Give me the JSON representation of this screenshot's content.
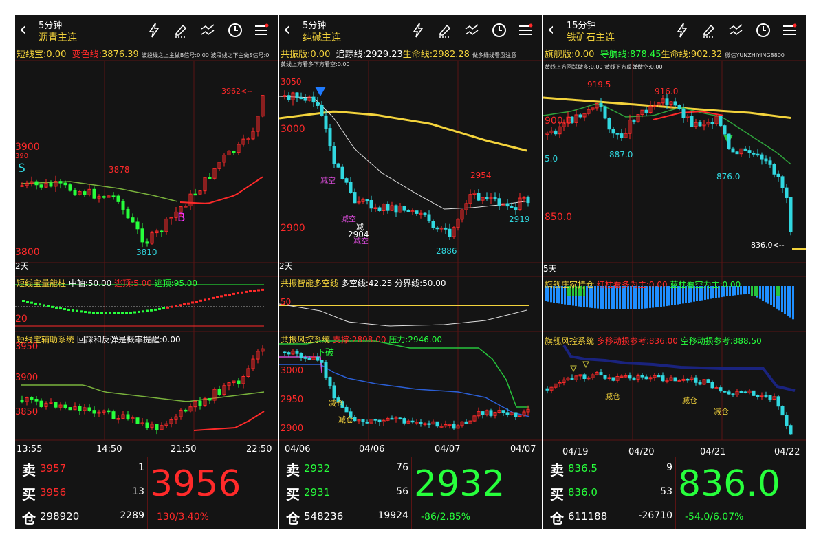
{
  "panels": [
    {
      "name": "asphalt",
      "period": "5分钟",
      "contract": "沥青主连",
      "ind_label": "短线宝:",
      "ind_value": "0.00",
      "ind2_label": "变色线:",
      "ind2_value": "3876.39",
      "ind_note": "波段线之上主做B信号:0.00 波段线之下主做S信号:0",
      "price_labels": [
        "3900",
        "3800",
        "390"
      ],
      "peak_label": "3962<--",
      "annotations": [
        "3878",
        "3810"
      ],
      "markers": [
        "S",
        "B"
      ],
      "day_label": "2天",
      "sub1_label": "短线宝量能柱",
      "sub1_a": "中轴:50.00",
      "sub1_b": "逃顶:5.00",
      "sub1_c": "逃顶:95.00",
      "sub1_scale": "20",
      "sub2_label": "短线宝辅助系统",
      "sub2_a": "回踩和反弹是概率提醒:0.00",
      "sub2_prices": [
        "3950",
        "3900",
        "3850"
      ],
      "x_labels": [
        "13:55",
        "14:50",
        "21:50",
        "22:50"
      ],
      "sell_label": "卖",
      "sell_price": "3957",
      "sell_vol": "1",
      "buy_label": "买",
      "buy_price": "3956",
      "buy_vol": "13",
      "oi_label": "仓",
      "oi_value": "298920",
      "oi_change": "2289",
      "last_price": "3956",
      "change": "130/3.40%"
    },
    {
      "name": "soda",
      "period": "5分钟",
      "contract": "纯碱主连",
      "ind_label": "共振版:",
      "ind_value": "0.00",
      "ind2_label": "追踪线:",
      "ind2_value": "2929.23",
      "ind3_label": "生命线:",
      "ind3_value": "2982.28",
      "ind_note": "做多绿线看盘注意",
      "ind_note2": "黄线上方看多下方看空:0.00",
      "price_labels": [
        "3050",
        "3000",
        "2900"
      ],
      "annotations": [
        "2954",
        "2919",
        "2904",
        "2886",
        "减空",
        "减空",
        "减",
        "减空"
      ],
      "day_label": "2天",
      "sub1_label": "共振智能多空线",
      "sub1_a": "多空线:42.25",
      "sub1_b": "分界线:50.00",
      "sub1_scale": "50",
      "sub2_label": "共振风控系统",
      "sub2_a": "支撑:2898.00",
      "sub2_b": "压力:2946.00",
      "sub2_prices": [
        "3000",
        "2950",
        "2900"
      ],
      "sub2_ann": [
        "下破",
        "减仓",
        "减仓"
      ],
      "x_labels": [
        "04/06",
        "04/06",
        "04/07",
        "04/07"
      ],
      "sell_label": "卖",
      "sell_price": "2932",
      "sell_vol": "76",
      "buy_label": "买",
      "buy_price": "2931",
      "buy_vol": "56",
      "oi_label": "仓",
      "oi_value": "548236",
      "oi_change": "19924",
      "last_price": "2932",
      "change": "-86/2.85%"
    },
    {
      "name": "iron",
      "period": "15分钟",
      "contract": "铁矿石主连",
      "ind_label": "旗舰版:",
      "ind_value": "0.00",
      "ind2_label": "导航线:",
      "ind2_value": "878.45",
      "ind3_label": "生命线:",
      "ind3_value": "902.32",
      "ind_note": "微信YUNZHIYING8800",
      "ind_note2": "黄线上方回踩做多:0.00 黄线下方反弹做空:0.00",
      "price_labels": [
        "900.0",
        "850.0",
        "5.0"
      ],
      "annotations": [
        "919.5",
        "916.0",
        "887.0",
        "876.0"
      ],
      "peak_label": "836.0<--",
      "day_label": "5天",
      "sub1_label": "旗舰庄家持仓",
      "sub1_a": "红柱看多为主:0.00",
      "sub1_b": "蓝柱看空为主:0.00",
      "sub2_label": "旗舰风控系统",
      "sub2_a": "多移动损参考:836.00",
      "sub2_b": "空移动损参考:888.50",
      "sub2_ann": [
        "减仓",
        "减仓",
        "减仓"
      ],
      "x_labels": [
        "04/19",
        "04/20",
        "04/21",
        "04/22"
      ],
      "sell_label": "卖",
      "sell_price": "836.5",
      "sell_vol": "9",
      "buy_label": "买",
      "buy_price": "836.0",
      "buy_vol": "53",
      "oi_label": "仓",
      "oi_value": "611188",
      "oi_change": "-26710",
      "last_price": "836.0",
      "change": "-54.0/6.07%"
    }
  ],
  "colors": {
    "up": "#ff2a2a",
    "down": "#27ff3c",
    "candle_down": "#31d8e0",
    "yellow": "#f3d33c",
    "bg": "#141414"
  },
  "icons": [
    "back-icon",
    "lightning-icon",
    "pen-icon",
    "draw-line-icon",
    "clock-icon",
    "menu-icon"
  ]
}
